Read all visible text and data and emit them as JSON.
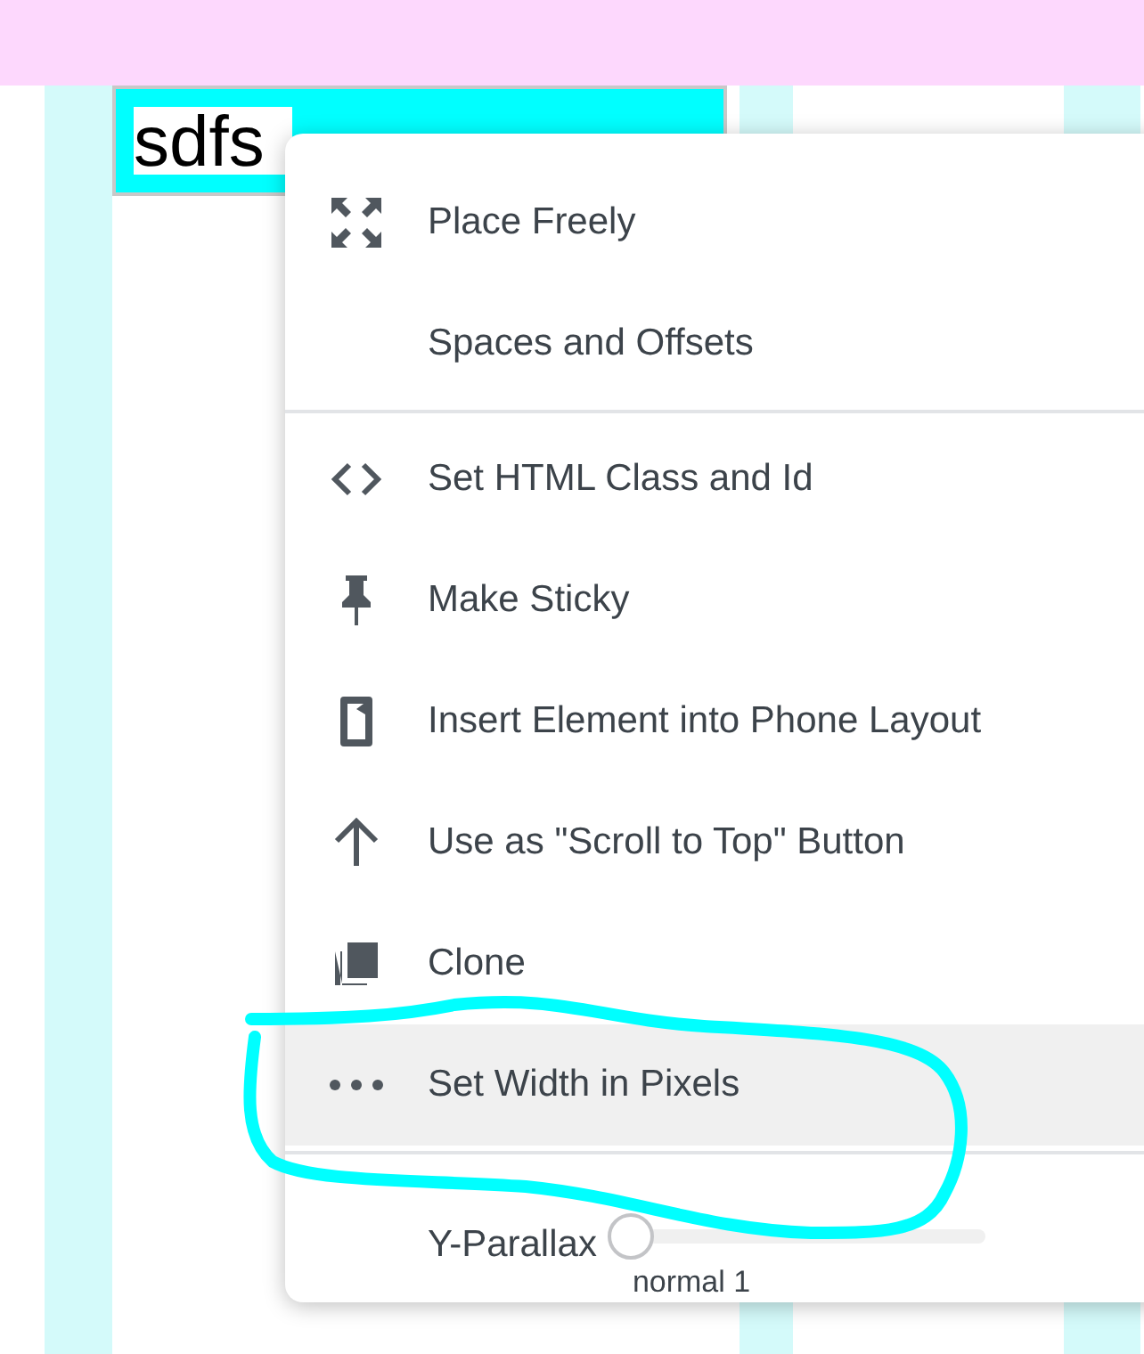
{
  "canvas": {
    "element_text": "sdfs"
  },
  "context_menu": {
    "items": [
      {
        "kind": "action",
        "label": "Place Freely",
        "selected": false
      },
      {
        "kind": "action",
        "label": "Spaces and Offsets",
        "selected": false
      },
      {
        "kind": "divider"
      },
      {
        "kind": "action",
        "label": "Set HTML Class and Id",
        "selected": false
      },
      {
        "kind": "action",
        "label": "Make Sticky",
        "selected": false
      },
      {
        "kind": "action",
        "label": "Insert Element into Phone Layout",
        "selected": false
      },
      {
        "kind": "action",
        "label": "Use as \"Scroll to Top\" Button",
        "selected": false
      },
      {
        "kind": "action",
        "label": "Clone",
        "selected": false
      },
      {
        "kind": "action",
        "label": "Set Width in Pixels",
        "selected": true
      },
      {
        "kind": "divider"
      },
      {
        "kind": "slider",
        "label": "Y-Parallax",
        "level": 0,
        "reading": "normal 1"
      }
    ]
  }
}
